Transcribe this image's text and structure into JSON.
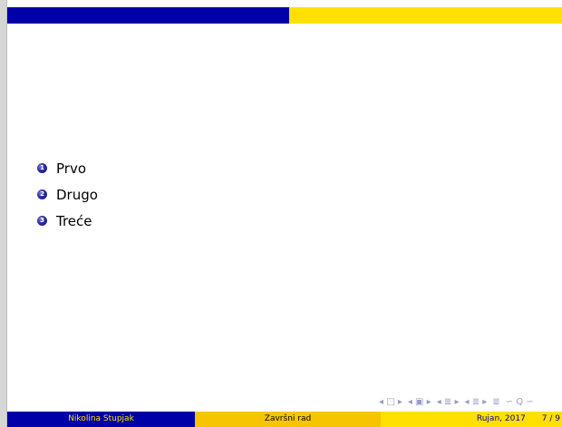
{
  "colors": {
    "blue": "#0000a8",
    "yellow": "#ffe000",
    "gold": "#f7c500"
  },
  "list": {
    "items": [
      {
        "number": "1",
        "label": "Prvo"
      },
      {
        "number": "2",
        "label": "Drugo"
      },
      {
        "number": "3",
        "label": "Treće"
      }
    ]
  },
  "nav": {
    "frame": "◂ □ ▸",
    "subsection": "◂ ▣ ▸",
    "section": "◂ ≣ ▸",
    "section_next": "◂ ≣ ▸",
    "align": "≣",
    "search": "∽ Q ∽"
  },
  "footer": {
    "author": "Nikolina Stupjak",
    "title": "Završni rad",
    "date": "Rujan, 2017",
    "page": "7 / 9"
  }
}
